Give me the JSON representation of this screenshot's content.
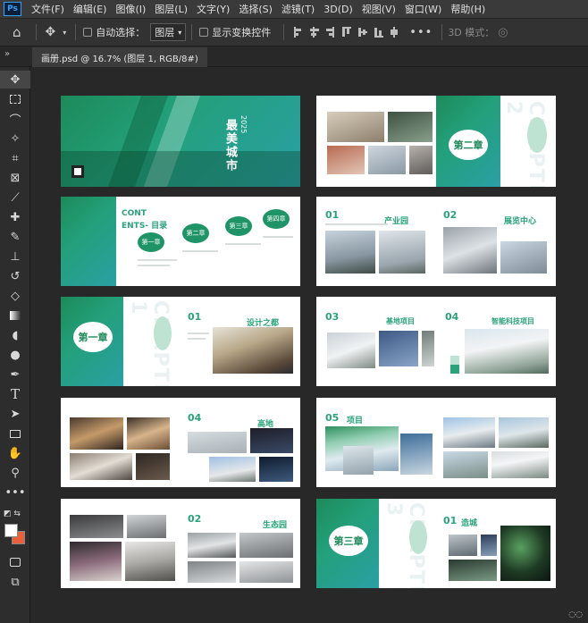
{
  "app": {
    "logo": "Ps"
  },
  "menu": [
    "文件(F)",
    "编辑(E)",
    "图像(I)",
    "图层(L)",
    "文字(Y)",
    "选择(S)",
    "滤镜(T)",
    "3D(D)",
    "视图(V)",
    "窗口(W)",
    "帮助(H)"
  ],
  "options": {
    "auto_select_label": "自动选择：",
    "layer_select": "图层",
    "show_transform_label": "显示变换控件",
    "mode_3d_label": "3D 模式："
  },
  "tab": {
    "title": "画册.psd @ 16.7% (图层 1, RGB/8#)"
  },
  "pages": {
    "cover": {
      "title": "最美城市",
      "year": "2025"
    },
    "contents": {
      "title_1": "CONT",
      "title_2": "ENTS- 目录",
      "items": [
        "第一章",
        "第二章",
        "第三章",
        "第四章"
      ]
    },
    "ch1": {
      "heading": "第一章",
      "watermark": "CHAPTER 1",
      "section_num": "01",
      "section_title": "设计之都"
    },
    "ch2": {
      "heading": "第二章",
      "watermark": "CHAPTER 2"
    },
    "ch3": {
      "heading": "第三章",
      "watermark": "CHAPTER 3",
      "section_num": "01",
      "section_title": "造城"
    },
    "p_industry": {
      "num1": "01",
      "title1": "产业园",
      "num2": "02",
      "title2": "展览中心"
    },
    "p_base": {
      "num1": "03",
      "title1": "基地项目",
      "num2": "04",
      "title2": "智能科技项目"
    },
    "p_high": {
      "num": "04",
      "title": "高地"
    },
    "p_05": {
      "num": "05",
      "title": "项目"
    },
    "p_eco": {
      "num": "02",
      "title": "生态园"
    }
  },
  "colors": {
    "brand_green": "#2aa37a",
    "brand_teal": "#2aa0a5",
    "ps_blue": "#2fa3f7",
    "bg_color": "#e8613a"
  }
}
